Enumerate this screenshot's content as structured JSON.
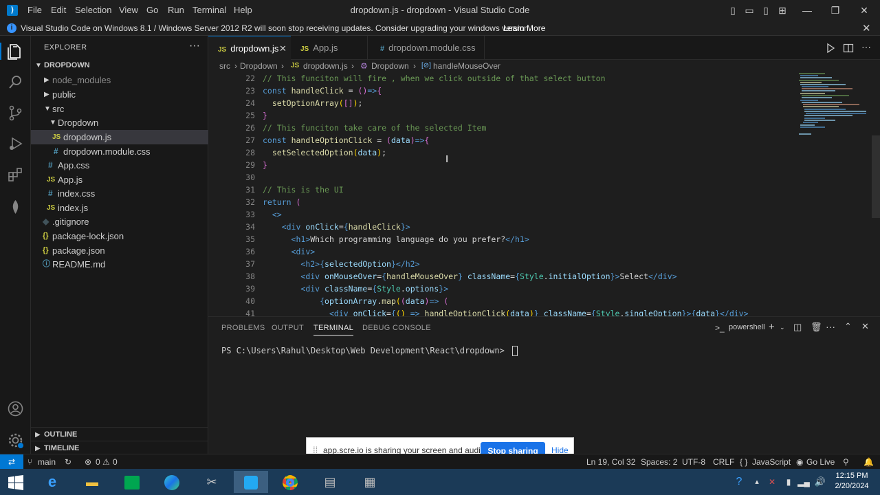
{
  "titlebar": {
    "menus": [
      "File",
      "Edit",
      "Selection",
      "View",
      "Go",
      "Run",
      "Terminal",
      "Help"
    ],
    "title": "dropdown.js - dropdown - Visual Studio Code"
  },
  "banner": {
    "message": "Visual Studio Code on Windows 8.1 / Windows Server 2012 R2 will soon stop receiving updates. Consider upgrading your windows version.",
    "link": "Learn More"
  },
  "explorer": {
    "header": "EXPLORER",
    "items": [
      {
        "label": "DROPDOWN",
        "kind": "root"
      },
      {
        "label": "node_modules",
        "kind": "folder",
        "depth": 1
      },
      {
        "label": "public",
        "kind": "folder",
        "depth": 1
      },
      {
        "label": "src",
        "kind": "folder-open",
        "depth": 1
      },
      {
        "label": "Dropdown",
        "kind": "folder-open",
        "depth": 2
      },
      {
        "label": "dropdown.js",
        "kind": "js",
        "depth": 3,
        "selected": true
      },
      {
        "label": "dropdown.module.css",
        "kind": "css",
        "depth": 3
      },
      {
        "label": "App.css",
        "kind": "css",
        "depth": 2
      },
      {
        "label": "App.js",
        "kind": "js",
        "depth": 2
      },
      {
        "label": "index.css",
        "kind": "css",
        "depth": 2
      },
      {
        "label": "index.js",
        "kind": "js",
        "depth": 2
      },
      {
        "label": ".gitignore",
        "kind": "git",
        "depth": 1
      },
      {
        "label": "package-lock.json",
        "kind": "json",
        "depth": 1
      },
      {
        "label": "package.json",
        "kind": "json",
        "depth": 1
      },
      {
        "label": "README.md",
        "kind": "info",
        "depth": 1
      }
    ],
    "outline": "OUTLINE",
    "timeline": "TIMELINE"
  },
  "tabs": [
    {
      "label": "dropdown.js",
      "type": "JS",
      "active": true
    },
    {
      "label": "App.js",
      "type": "JS",
      "active": false
    },
    {
      "label": "dropdown.module.css",
      "type": "#",
      "active": false
    }
  ],
  "breadcrumb": [
    "src",
    "Dropdown",
    "dropdown.js",
    "Dropdown",
    "handleMouseOver"
  ],
  "editor": {
    "line_numbers": [
      "22",
      "23",
      "24",
      "25",
      "26",
      "27",
      "28",
      "29",
      "30",
      "31",
      "32",
      "33",
      "34",
      "35",
      "36",
      "37",
      "38",
      "39",
      "40",
      "41"
    ]
  },
  "panel": {
    "tabs": [
      "PROBLEMS",
      "OUTPUT",
      "TERMINAL",
      "DEBUG CONSOLE"
    ],
    "active_tab": "TERMINAL",
    "shell": "powershell",
    "prompt": "PS C:\\Users\\Rahul\\Desktop\\Web Development\\React\\dropdown>"
  },
  "share": {
    "text": "app.scre.io is sharing your screen and audio.",
    "stop": "Stop sharing",
    "hide": "Hide"
  },
  "status": {
    "branch": "main",
    "errors": "0",
    "warnings": "0",
    "position": "Ln 19, Col 32",
    "spaces": "Spaces: 2",
    "encoding": "UTF-8",
    "eol": "CRLF",
    "language": "JavaScript",
    "golive": "Go Live"
  },
  "clock": {
    "time": "12:15 PM",
    "date": "2/20/2024"
  },
  "colors": {
    "accent": "#0078d4",
    "taskbar": "#1b3a57",
    "statusbar": "#181818"
  }
}
